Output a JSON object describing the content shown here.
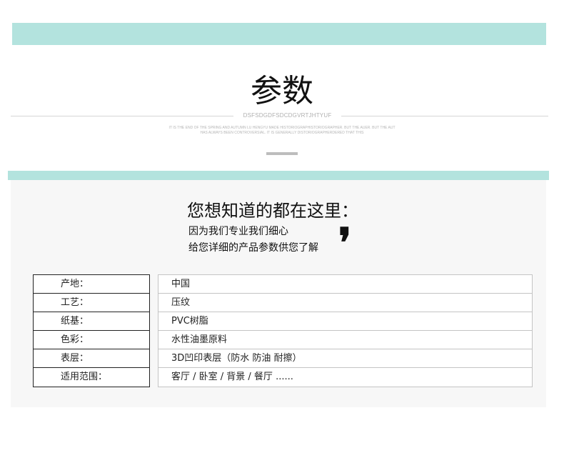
{
  "header": {
    "title": "参数",
    "subtitle": "DSFSDGDFSDCDGVRTJHTYUF",
    "blurb_line1": "IT IS THE END OF THE SPRING AND AUTUMN LU HENGYU MADE HISTORIOGRAPHISTORIOGRAPHER. BUT THE AUER. BUT THE AUT",
    "blurb_line2": "HAS ALWAYS BEEN CONTROVERSIAL. IT IS GENERALLY DISTORIOGRAPHERDERED THAT THIS"
  },
  "intro": {
    "heading": "您想知道的都在这里：",
    "line1": "因为我们专业我们细心",
    "line2": "给您详细的产品参数供您了解",
    "quote_mark": "❜"
  },
  "specs": [
    {
      "label": "产地：",
      "value": "中国"
    },
    {
      "label": "工艺：",
      "value": "压纹"
    },
    {
      "label": "纸基：",
      "value": "PVC树脂"
    },
    {
      "label": "色彩：",
      "value": "水性油墨原料"
    },
    {
      "label": "表层：",
      "value": "3D凹印表层（防水  防油  耐擦）"
    },
    {
      "label": "适用范围：",
      "value": "客厅 / 卧室 / 背景 / 餐厅 ......"
    }
  ],
  "colors": {
    "accent_band": "#b3e3de",
    "panel_bg": "#f7f7f7"
  }
}
